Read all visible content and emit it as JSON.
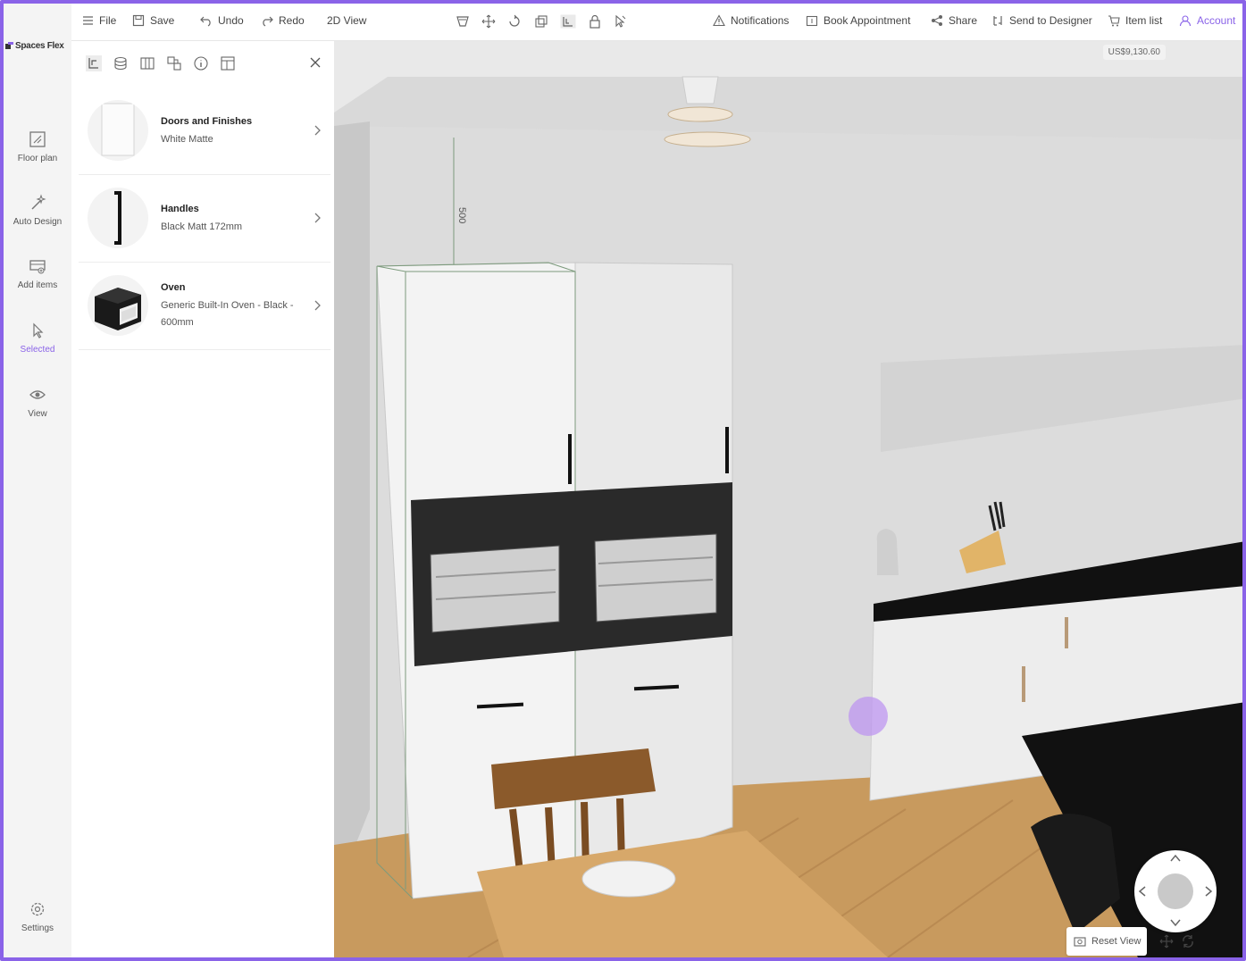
{
  "app": {
    "brand": "Spaces Flex"
  },
  "rail": {
    "items": [
      {
        "label": "Floor plan",
        "icon": "floor-plan-icon"
      },
      {
        "label": "Auto Design",
        "icon": "magic-wand-icon"
      },
      {
        "label": "Add items",
        "icon": "add-items-icon"
      },
      {
        "label": "Selected",
        "icon": "cursor-icon",
        "active": true
      },
      {
        "label": "View",
        "icon": "eye-icon"
      }
    ],
    "settings": "Settings"
  },
  "toolbar": {
    "file": "File",
    "save": "Save",
    "undo": "Undo",
    "redo": "Redo",
    "view2d": "2D View",
    "notifications": "Notifications",
    "book": "Book Appointment",
    "share": "Share",
    "send": "Send to Designer",
    "itemlist": "Item list",
    "account": "Account"
  },
  "panel": {
    "cards": [
      {
        "title": "Doors and Finishes",
        "sub": "White Matte"
      },
      {
        "title": "Handles",
        "sub": "Black Matt 172mm"
      },
      {
        "title": "Oven",
        "sub": "Generic Built-In Oven - Black - 600mm"
      }
    ]
  },
  "viewport": {
    "price": "US$9,130.60",
    "dimension_label": "500",
    "reset_view": "Reset View"
  },
  "colors": {
    "accent": "#8a63e8",
    "frame": "#8a63e8"
  }
}
